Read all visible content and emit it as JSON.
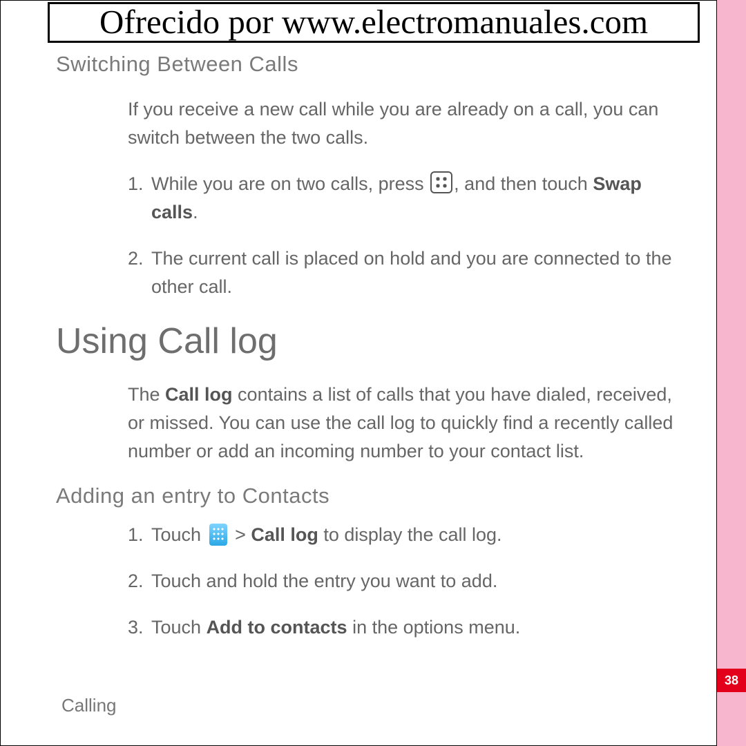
{
  "banner": "Ofrecido por www.electromanuales.com",
  "section1": {
    "heading": "Switching Between Calls",
    "intro": "If you receive a new call while you are already on a call, you can switch between the two calls.",
    "step1_a": "While you are on two calls, press ",
    "step1_b": ", and then touch ",
    "step1_bold": "Swap calls",
    "step1_c": ".",
    "step2": "The current call is placed on hold and you are connected to the other call."
  },
  "section2": {
    "heading": "Using Call log",
    "intro_a": "The ",
    "intro_bold": "Call log",
    "intro_b": " contains a list of calls that you have dialed, received, or missed. You can use the call log to quickly find a recently called number or add an incoming number to your contact list."
  },
  "section3": {
    "heading": "Adding an entry to Contacts",
    "step1_a": "Touch ",
    "step1_b": " > ",
    "step1_bold": "Call log",
    "step1_c": " to display the call log.",
    "step2": "Touch and hold the entry you want to add.",
    "step3_a": "Touch ",
    "step3_bold": "Add to contacts",
    "step3_b": " in the options menu."
  },
  "footer": "Calling",
  "page_number": "38"
}
